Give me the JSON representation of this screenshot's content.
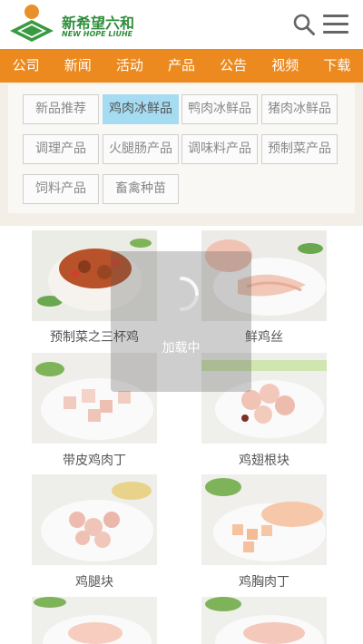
{
  "header": {
    "brand_cn": "新希望六和",
    "brand_en": "NEW HOPE LIUHE"
  },
  "nav": [
    "公司",
    "新闻",
    "活动",
    "产品",
    "公告",
    "视频",
    "下载"
  ],
  "categories": [
    {
      "label": "新品推荐",
      "active": false
    },
    {
      "label": "鸡肉冰鲜品",
      "active": true
    },
    {
      "label": "鸭肉冰鲜品",
      "active": false
    },
    {
      "label": "猪肉冰鲜品",
      "active": false
    },
    {
      "label": "调理产品",
      "active": false
    },
    {
      "label": "火腿肠产品",
      "active": false
    },
    {
      "label": "调味料产品",
      "active": false
    },
    {
      "label": "预制菜产品",
      "active": false
    },
    {
      "label": "饲料产品",
      "active": false
    },
    {
      "label": "畜禽种苗",
      "active": false
    }
  ],
  "products": [
    {
      "name": "预制菜之三杯鸡"
    },
    {
      "name": "鲜鸡丝"
    },
    {
      "name": "带皮鸡肉丁"
    },
    {
      "name": "鸡翅根块"
    },
    {
      "name": "鸡腿块"
    },
    {
      "name": "鸡胸肉丁"
    },
    {
      "name": ""
    },
    {
      "name": ""
    }
  ],
  "loading": {
    "text": "加载中"
  },
  "colors": {
    "brand_green": "#2f8e3c",
    "nav_orange": "#ec8a1f",
    "active_blue": "#a6dcf2",
    "panel_bg": "#f4efe6"
  }
}
